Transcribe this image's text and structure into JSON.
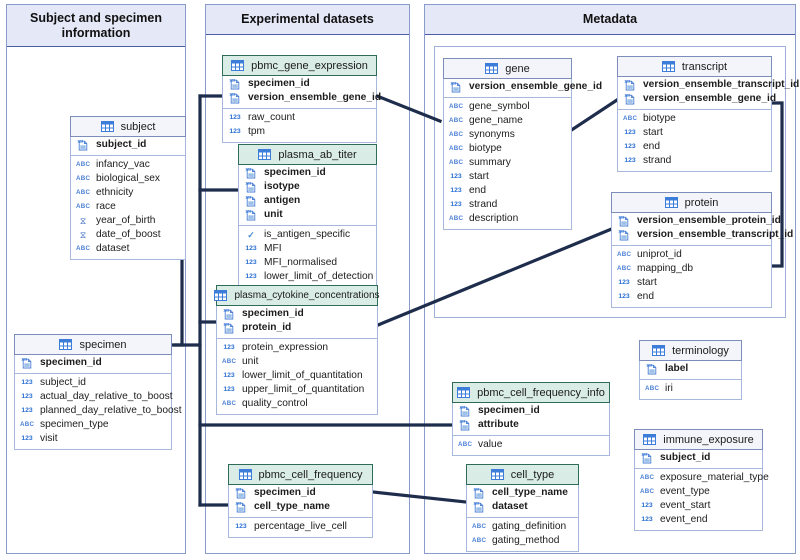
{
  "panels": [
    {
      "id": "subject_panel",
      "title": "Subject and specimen information"
    },
    {
      "id": "experimental_panel",
      "title": "Experimental datasets"
    },
    {
      "id": "metadata_panel",
      "title": "Metadata"
    }
  ],
  "colors": {
    "panel_header_fill": "#e4e8f7",
    "panel_border": "#4a5ea8",
    "entity_blue_header": "#f3f5fa",
    "entity_blue_border": "#7b8db8",
    "entity_green_header": "#d9ece5",
    "entity_green_border": "#2f6b59",
    "connector": "#1f2d4d",
    "icon_blue": "#2a6fd4"
  },
  "tables": {
    "subject": {
      "name": "subject",
      "style": "blue",
      "keys": [
        {
          "label": "subject_id",
          "icon": "key-icon"
        }
      ],
      "fields": [
        {
          "label": "infancy_vac",
          "icon": "abc-icon"
        },
        {
          "label": "biological_sex",
          "icon": "abc-icon"
        },
        {
          "label": "ethnicity",
          "icon": "abc-icon"
        },
        {
          "label": "race",
          "icon": "abc-icon"
        },
        {
          "label": "year_of_birth",
          "icon": "date-icon"
        },
        {
          "label": "date_of_boost",
          "icon": "date-icon"
        },
        {
          "label": "dataset",
          "icon": "abc-icon"
        }
      ]
    },
    "specimen": {
      "name": "specimen",
      "style": "blue",
      "keys": [
        {
          "label": "specimen_id",
          "icon": "key-icon"
        }
      ],
      "fields": [
        {
          "label": "subject_id",
          "icon": "num-icon"
        },
        {
          "label": "actual_day_relative_to_boost",
          "icon": "num-icon"
        },
        {
          "label": "planned_day_relative_to_boost",
          "icon": "num-icon"
        },
        {
          "label": "specimen_type",
          "icon": "abc-icon"
        },
        {
          "label": "visit",
          "icon": "num-icon"
        }
      ]
    },
    "pbmc_gene_expression": {
      "name": "pbmc_gene_expression",
      "style": "green",
      "keys": [
        {
          "label": "specimen_id",
          "icon": "key-icon"
        },
        {
          "label": "version_ensemble_gene_id",
          "icon": "key-icon"
        }
      ],
      "fields": [
        {
          "label": "raw_count",
          "icon": "num-icon"
        },
        {
          "label": "tpm",
          "icon": "num-icon"
        }
      ]
    },
    "plasma_ab_titer": {
      "name": "plasma_ab_titer",
      "style": "green",
      "keys": [
        {
          "label": "specimen_id",
          "icon": "key-icon"
        },
        {
          "label": "isotype",
          "icon": "key-icon"
        },
        {
          "label": "antigen",
          "icon": "key-icon"
        },
        {
          "label": "unit",
          "icon": "key-icon"
        }
      ],
      "fields": [
        {
          "label": "is_antigen_specific",
          "icon": "check-icon"
        },
        {
          "label": "MFI",
          "icon": "num-icon"
        },
        {
          "label": "MFI_normalised",
          "icon": "num-icon"
        },
        {
          "label": "lower_limit_of_detection",
          "icon": "num-icon"
        }
      ]
    },
    "plasma_cytokine_concentrations": {
      "name": "plasma_cytokine_concentrations",
      "style": "green",
      "keys": [
        {
          "label": "specimen_id",
          "icon": "key-icon"
        },
        {
          "label": "protein_id",
          "icon": "key-icon"
        }
      ],
      "fields": [
        {
          "label": "protein_expression",
          "icon": "num-icon"
        },
        {
          "label": "unit",
          "icon": "abc-icon"
        },
        {
          "label": "lower_limit_of_quantitation",
          "icon": "num-icon"
        },
        {
          "label": "upper_limit_of_quantitation",
          "icon": "num-icon"
        },
        {
          "label": "quality_control",
          "icon": "abc-icon"
        }
      ]
    },
    "pbmc_cell_frequency": {
      "name": "pbmc_cell_frequency",
      "style": "green",
      "keys": [
        {
          "label": "specimen_id",
          "icon": "key-icon"
        },
        {
          "label": "cell_type_name",
          "icon": "key-icon"
        }
      ],
      "fields": [
        {
          "label": "percentage_live_cell",
          "icon": "num-icon"
        }
      ]
    },
    "pbmc_cell_frequency_info": {
      "name": "pbmc_cell_frequency_info",
      "style": "green",
      "keys": [
        {
          "label": "specimen_id",
          "icon": "key-icon"
        },
        {
          "label": "attribute",
          "icon": "key-icon"
        }
      ],
      "fields": [
        {
          "label": "value",
          "icon": "abc-icon"
        }
      ]
    },
    "cell_type": {
      "name": "cell_type",
      "style": "green",
      "keys": [
        {
          "label": "cell_type_name",
          "icon": "key-icon"
        },
        {
          "label": "dataset",
          "icon": "key-icon"
        }
      ],
      "fields": [
        {
          "label": "gating_definition",
          "icon": "abc-icon"
        },
        {
          "label": "gating_method",
          "icon": "abc-icon"
        }
      ]
    },
    "gene": {
      "name": "gene",
      "style": "blue",
      "keys": [
        {
          "label": "version_ensemble_gene_id",
          "icon": "key-icon"
        }
      ],
      "fields": [
        {
          "label": "gene_symbol",
          "icon": "abc-icon"
        },
        {
          "label": "gene_name",
          "icon": "abc-icon"
        },
        {
          "label": "synonyms",
          "icon": "abc-icon"
        },
        {
          "label": "biotype",
          "icon": "abc-icon"
        },
        {
          "label": "summary",
          "icon": "abc-icon"
        },
        {
          "label": "start",
          "icon": "num-icon"
        },
        {
          "label": "end",
          "icon": "num-icon"
        },
        {
          "label": "strand",
          "icon": "num-icon"
        },
        {
          "label": "description",
          "icon": "abc-icon"
        }
      ]
    },
    "transcript": {
      "name": "transcript",
      "style": "blue",
      "keys": [
        {
          "label": "version_ensemble_transcript_id",
          "icon": "key-icon"
        },
        {
          "label": "version_ensemble_gene_id",
          "icon": "key-icon"
        }
      ],
      "fields": [
        {
          "label": "biotype",
          "icon": "abc-icon"
        },
        {
          "label": "start",
          "icon": "num-icon"
        },
        {
          "label": "end",
          "icon": "num-icon"
        },
        {
          "label": "strand",
          "icon": "num-icon"
        }
      ]
    },
    "protein": {
      "name": "protein",
      "style": "blue",
      "keys": [
        {
          "label": "version_ensemble_protein_id",
          "icon": "key-icon"
        },
        {
          "label": "version_ensemble_transcript_id",
          "icon": "key-icon"
        }
      ],
      "fields": [
        {
          "label": "uniprot_id",
          "icon": "abc-icon"
        },
        {
          "label": "mapping_db",
          "icon": "abc-icon"
        },
        {
          "label": "start",
          "icon": "num-icon"
        },
        {
          "label": "end",
          "icon": "num-icon"
        }
      ]
    },
    "terminology": {
      "name": "terminology",
      "style": "blue",
      "keys": [
        {
          "label": "label",
          "icon": "key-icon"
        }
      ],
      "fields": [
        {
          "label": "iri",
          "icon": "abc-icon"
        }
      ]
    },
    "immune_exposure": {
      "name": "immune_exposure",
      "style": "blue",
      "keys": [
        {
          "label": "subject_id",
          "icon": "key-icon"
        }
      ],
      "fields": [
        {
          "label": "exposure_material_type",
          "icon": "abc-icon"
        },
        {
          "label": "event_type",
          "icon": "abc-icon"
        },
        {
          "label": "event_start",
          "icon": "num-icon"
        },
        {
          "label": "event_end",
          "icon": "num-icon"
        }
      ]
    }
  },
  "icon_glyphs": {
    "abc-icon": "ABC",
    "num-icon": "123",
    "date-icon": "⧖",
    "check-icon": "✓"
  },
  "relationships": [
    {
      "from": "subject",
      "to": "specimen",
      "label": ""
    },
    {
      "from": "specimen",
      "to": "pbmc_gene_expression",
      "label": ""
    },
    {
      "from": "specimen",
      "to": "plasma_ab_titer",
      "label": ""
    },
    {
      "from": "specimen",
      "to": "plasma_cytokine_concentrations",
      "label": ""
    },
    {
      "from": "specimen",
      "to": "pbmc_cell_frequency",
      "label": ""
    },
    {
      "from": "specimen",
      "to": "pbmc_cell_frequency_info",
      "label": ""
    },
    {
      "from": "pbmc_gene_expression",
      "to": "gene",
      "label": ""
    },
    {
      "from": "gene",
      "to": "transcript",
      "label": ""
    },
    {
      "from": "transcript",
      "to": "protein",
      "label": ""
    },
    {
      "from": "protein",
      "to": "plasma_cytokine_concentrations",
      "label": ""
    },
    {
      "from": "pbmc_cell_frequency",
      "to": "cell_type",
      "label": ""
    }
  ]
}
